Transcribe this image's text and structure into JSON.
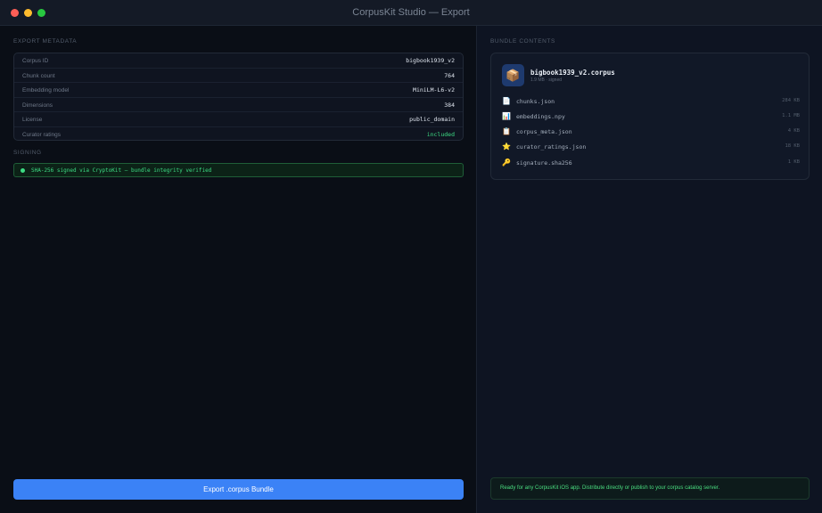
{
  "window": {
    "title": "CorpusKit Studio — Export",
    "traffic_lights": [
      "#ff5f57",
      "#febc2e",
      "#28c840"
    ]
  },
  "left_panel": {
    "metadata_label": "EXPORT METADATA",
    "metadata": [
      {
        "key": "Corpus ID",
        "value": "bigbook1939_v2"
      },
      {
        "key": "Chunk count",
        "value": "764"
      },
      {
        "key": "Embedding model",
        "value": "MiniLM-L6-v2"
      },
      {
        "key": "Dimensions",
        "value": "384"
      },
      {
        "key": "License",
        "value": "public_domain"
      },
      {
        "key": "Curator ratings",
        "value": "included"
      }
    ],
    "signing_label": "SIGNING",
    "signing_status": "SHA-256 signed via CryptoKit — bundle integrity verified",
    "export_button": "Export .corpus Bundle"
  },
  "right_panel": {
    "contents_label": "BUNDLE CONTENTS",
    "bundle": {
      "name": "bigbook1939_v2.corpus",
      "subtitle": "1.9 MB · signed",
      "icon": "package-icon"
    },
    "files": [
      {
        "icon": "document-icon",
        "glyph": "📄",
        "name": "chunks.json",
        "size": "284 KB"
      },
      {
        "icon": "chart-icon",
        "glyph": "📊",
        "name": "embeddings.npy",
        "size": "1.1 MB"
      },
      {
        "icon": "clipboard-icon",
        "glyph": "📋",
        "name": "corpus_meta.json",
        "size": "4 KB"
      },
      {
        "icon": "star-icon",
        "glyph": "⭐",
        "name": "curator_ratings.json",
        "size": "18 KB"
      },
      {
        "icon": "key-icon",
        "glyph": "🔑",
        "name": "signature.sha256",
        "size": "1 KB"
      }
    ],
    "ready_message": "Ready for any CorpusKit iOS app. Distribute directly or publish to your corpus catalog server."
  },
  "colors": {
    "accent": "#3b82f6",
    "success": "#3ddc84",
    "background": "#0b0f17"
  }
}
